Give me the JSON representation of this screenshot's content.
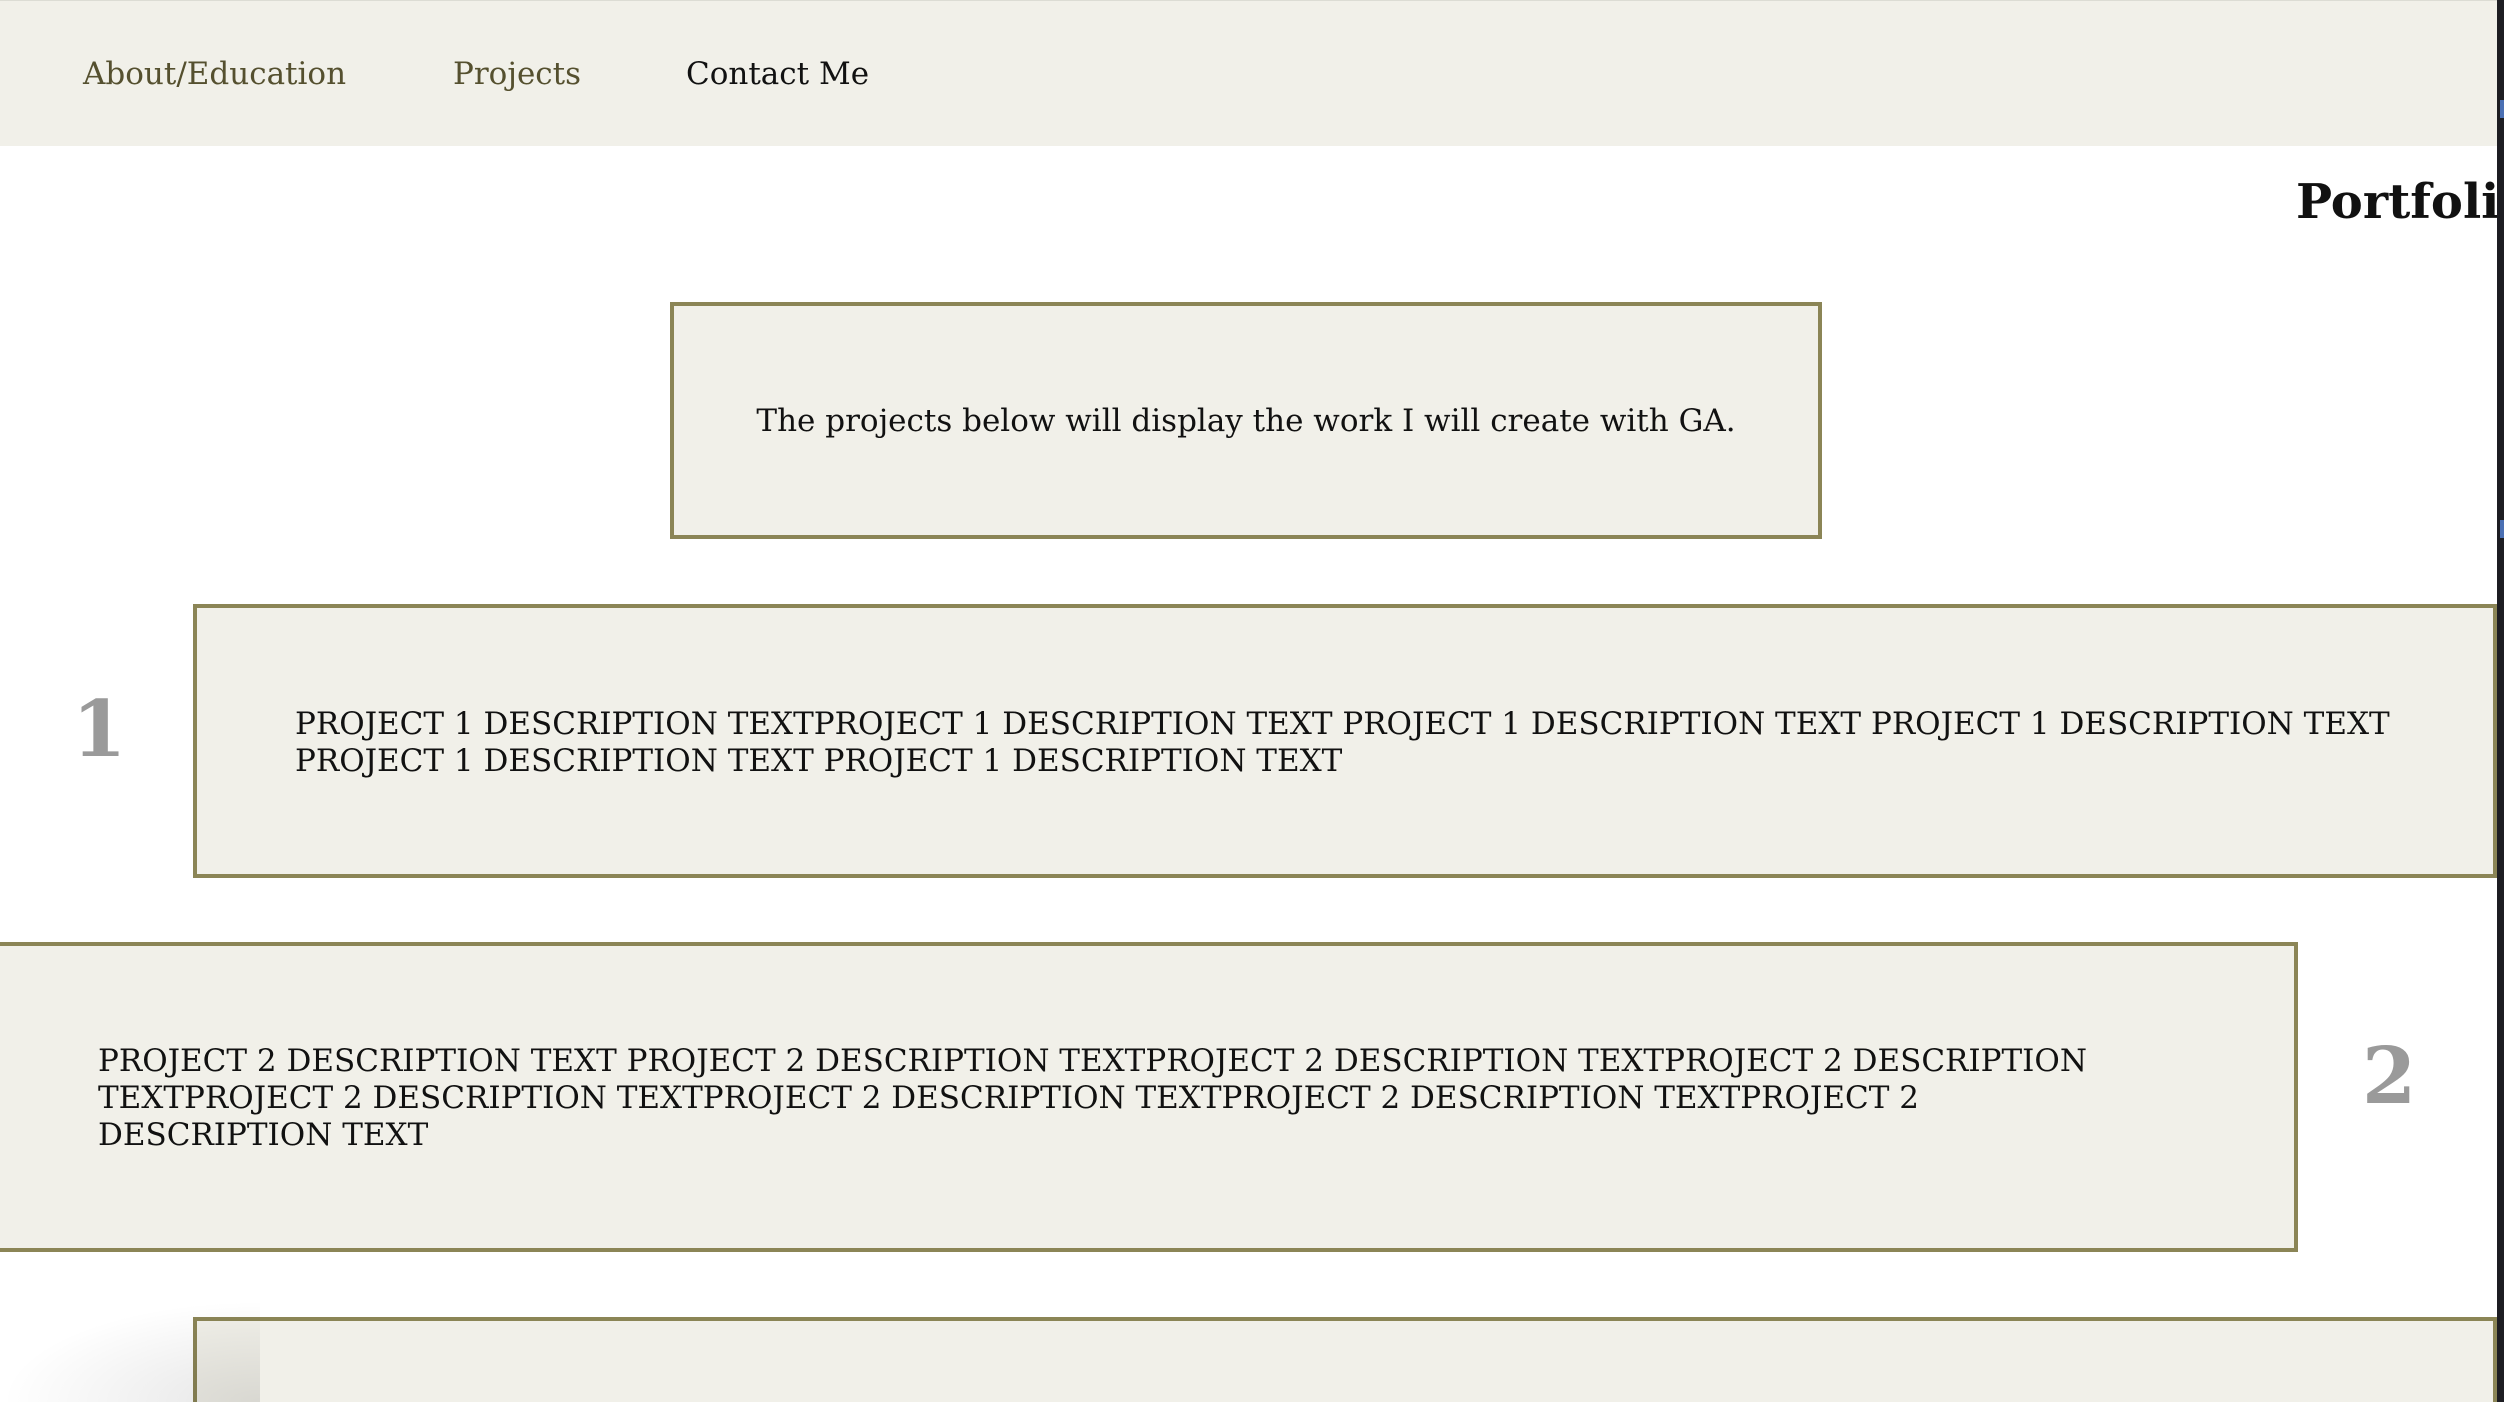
{
  "nav": {
    "items": [
      {
        "label": "About/Education"
      },
      {
        "label": "Projects"
      },
      {
        "label": "Contact Me"
      }
    ]
  },
  "brand": {
    "title": "Portfolio"
  },
  "intro": {
    "text": "The projects below will display the work I will create with GA."
  },
  "projects": [
    {
      "number": "1",
      "description": "PROJECT 1 DESCRIPTION TEXTPROJECT 1 DESCRIPTION TEXT PROJECT 1 DESCRIPTION TEXT PROJECT 1 DESCRIPTION TEXT PROJECT 1 DESCRIPTION TEXT PROJECT 1 DESCRIPTION TEXT"
    },
    {
      "number": "2",
      "description": "PROJECT 2 DESCRIPTION TEXT PROJECT 2 DESCRIPTION TEXTPROJECT 2 DESCRIPTION TEXTPROJECT 2 DESCRIPTION TEXTPROJECT 2 DESCRIPTION TEXTPROJECT 2 DESCRIPTION TEXTPROJECT 2 DESCRIPTION TEXTPROJECT 2 DESCRIPTION TEXT"
    }
  ],
  "colors": {
    "panel_background": "#f1f0e9",
    "border": "#8b8556",
    "nav_link": "#55502f",
    "number": "#9a9a9a"
  }
}
